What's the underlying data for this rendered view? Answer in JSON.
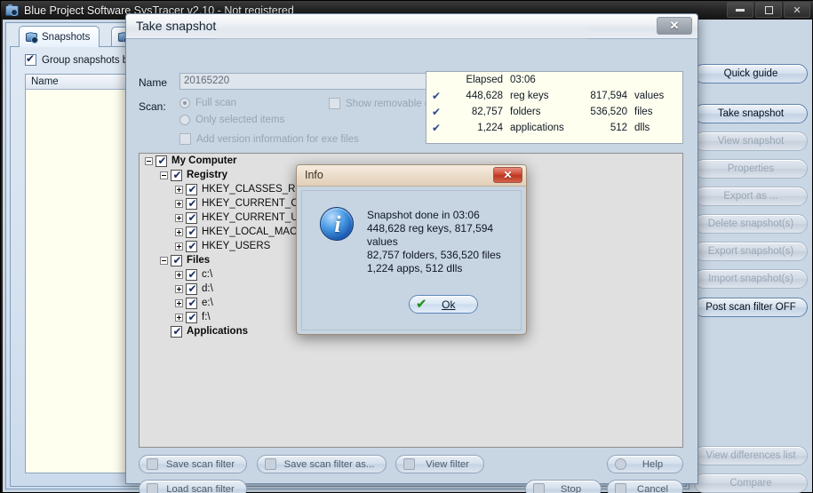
{
  "main_window": {
    "title": "Blue Project Software SysTracer v2.10 - Not registered",
    "icon": "camera-icon",
    "controls": {
      "minimize": "minimize-icon",
      "maximize": "maximize-icon",
      "close": "✕"
    }
  },
  "tabs": [
    {
      "label": "Snapshots",
      "icon": "camera-icon",
      "active": true
    },
    {
      "label": "",
      "icon": "monitor-icon",
      "active": false
    }
  ],
  "left_panel": {
    "group_checkbox": {
      "label": "Group snapshots by c",
      "checked": true
    },
    "list_columns": [
      "Name"
    ],
    "list_rows": []
  },
  "sidebar": {
    "buttons": [
      {
        "label": "Quick guide",
        "enabled": true
      },
      {
        "label": "Take snapshot",
        "enabled": true
      },
      {
        "label": "View snapshot",
        "enabled": false
      },
      {
        "label": "Properties",
        "enabled": false
      },
      {
        "label": "Export as ...",
        "enabled": false
      },
      {
        "label": "Delete snapshot(s)",
        "enabled": false
      },
      {
        "label": "Export snapshot(s)",
        "enabled": false
      },
      {
        "label": "Import snapshot(s)",
        "enabled": false
      },
      {
        "label": "Post scan filter OFF",
        "enabled": true
      }
    ],
    "bottom_buttons": [
      {
        "label": "View differences list",
        "enabled": false
      },
      {
        "label": "Compare",
        "enabled": false
      }
    ]
  },
  "snapshot_dialog": {
    "title": "Take snapshot",
    "close_label": "✕",
    "name_label": "Name",
    "name_value": "20165220",
    "scan_label": "Scan:",
    "options": {
      "full_scan": {
        "label": "Full scan",
        "selected": true
      },
      "only_selected": {
        "label": "Only selected items",
        "selected": false
      },
      "add_version": {
        "label": "Add version information for exe files",
        "checked": false
      },
      "show_removable": {
        "label": "Show removable disks",
        "checked": false
      }
    },
    "stats": {
      "elapsed_label": "Elapsed",
      "elapsed_value": "03:06",
      "rows": [
        {
          "check": "✔",
          "num": "448,628",
          "label": "reg keys",
          "num2": "817,594",
          "label2": "values"
        },
        {
          "check": "✔",
          "num": "82,757",
          "label": "folders",
          "num2": "536,520",
          "label2": "files"
        },
        {
          "check": "✔",
          "num": "1,224",
          "label": "applications",
          "num2": "512",
          "label2": "dlls"
        }
      ]
    },
    "tree": [
      {
        "label": "My Computer",
        "indent": 0,
        "expander": "minus",
        "checked": true,
        "bold": true
      },
      {
        "label": "Registry",
        "indent": 1,
        "expander": "minus",
        "checked": true,
        "bold": true
      },
      {
        "label": "HKEY_CLASSES_ROOT",
        "indent": 2,
        "expander": "plus",
        "checked": true,
        "bold": false
      },
      {
        "label": "HKEY_CURRENT_CONFIG",
        "indent": 2,
        "expander": "plus",
        "checked": true,
        "bold": false
      },
      {
        "label": "HKEY_CURRENT_USER",
        "indent": 2,
        "expander": "plus",
        "checked": true,
        "bold": false
      },
      {
        "label": "HKEY_LOCAL_MACHINE",
        "indent": 2,
        "expander": "plus",
        "checked": true,
        "bold": false
      },
      {
        "label": "HKEY_USERS",
        "indent": 2,
        "expander": "plus",
        "checked": true,
        "bold": false
      },
      {
        "label": "Files",
        "indent": 1,
        "expander": "minus",
        "checked": true,
        "bold": true
      },
      {
        "label": "c:\\",
        "indent": 2,
        "expander": "plus",
        "checked": true,
        "bold": false
      },
      {
        "label": "d:\\",
        "indent": 2,
        "expander": "plus",
        "checked": true,
        "bold": false
      },
      {
        "label": "e:\\",
        "indent": 2,
        "expander": "plus",
        "checked": true,
        "bold": false
      },
      {
        "label": "f:\\",
        "indent": 2,
        "expander": "plus",
        "checked": true,
        "bold": false
      },
      {
        "label": "Applications",
        "indent": 1,
        "expander": "none",
        "checked": true,
        "bold": true
      }
    ],
    "buttons": {
      "save_scan_filter": "Save scan filter",
      "save_scan_filter_as": "Save scan filter as...",
      "view_filter": "View filter",
      "load_scan_filter": "Load scan filter",
      "help": "Help",
      "stop": "Stop",
      "cancel": "Cancel"
    }
  },
  "info_dialog": {
    "title": "Info",
    "close_label": "✕",
    "icon": "info-icon",
    "lines": [
      "Snapshot done in 03:06",
      "448,628 reg keys, 817,594 values",
      "82,757 folders, 536,520 files",
      "1,224 apps, 512 dlls"
    ],
    "ok_label": "Ok",
    "ok_icon": "✔"
  },
  "colors": {
    "dialog_bg": "#c8d5e3",
    "accent_blue": "#2b4a8c",
    "info_title": "#eadbc8",
    "close_red": "#cf4a33",
    "check_green": "#1c8a1c"
  }
}
